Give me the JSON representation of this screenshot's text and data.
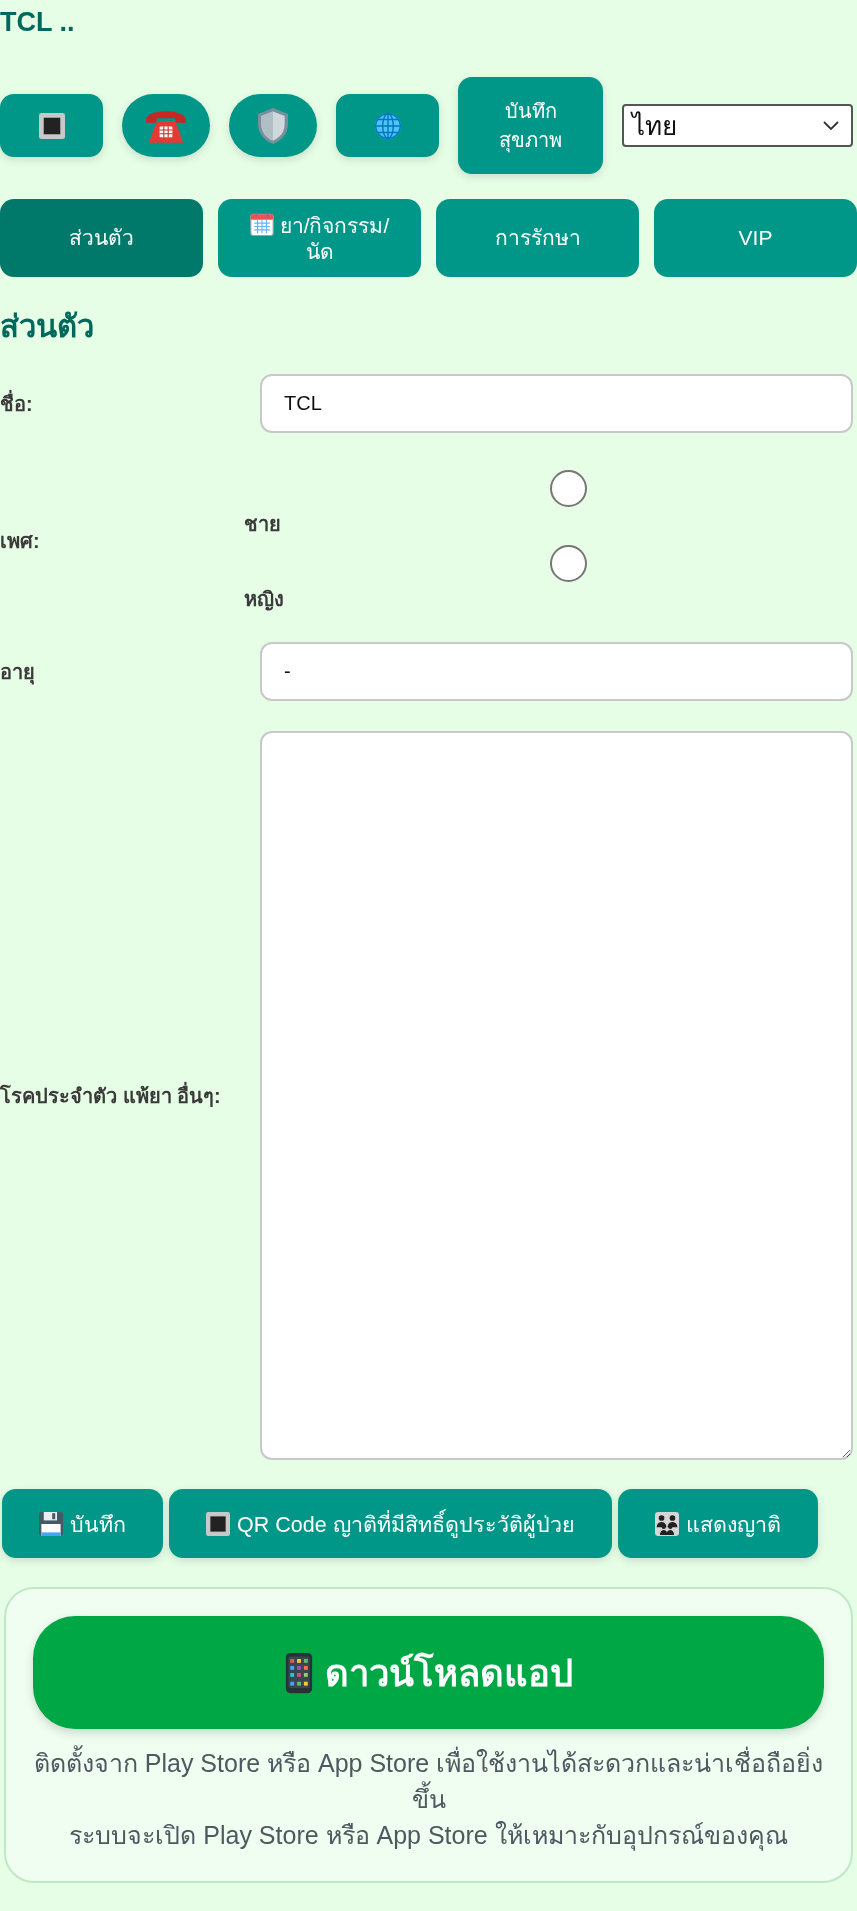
{
  "header": {
    "title": "TCL .."
  },
  "toolbar": {
    "buttons": [
      {
        "kind": "square"
      },
      {
        "kind": "phone"
      },
      {
        "kind": "shield"
      },
      {
        "kind": "globe"
      },
      {
        "kind": "text",
        "label": "บันทึก สุขภาพ"
      }
    ],
    "language_select": {
      "value": "ไทย"
    }
  },
  "tabs": [
    {
      "kind": "plain",
      "label": "ส่วนตัว",
      "selected": true
    },
    {
      "kind": "calendar",
      "label": "ยา/กิจกรรม/นัด",
      "selected": false
    },
    {
      "kind": "plain",
      "label": "การรักษา",
      "selected": false
    },
    {
      "kind": "plain",
      "label": "VIP",
      "selected": false
    }
  ],
  "form": {
    "heading": "ส่วนตัว",
    "fields": [
      {
        "kind": "text",
        "label": "ชื่อ:",
        "value": "TCL"
      },
      {
        "kind": "radio",
        "label": "เพศ:",
        "options": [
          {
            "label": "ชาย",
            "selected": false
          },
          {
            "label": "หญิง",
            "selected": false
          }
        ]
      },
      {
        "kind": "text",
        "label": "อายุ",
        "value": "-"
      },
      {
        "kind": "textarea",
        "label": "โรคประจำตัว แพ้ยา อื่นๆ:"
      }
    ]
  },
  "actions": [
    {
      "kind": "save",
      "label": "บันทึก"
    },
    {
      "kind": "qr",
      "label": "QR Code ญาติที่มีสิทธิ์ดูประวัติผู้ป่วย"
    },
    {
      "kind": "family",
      "label": "แสดงญาติ"
    }
  ],
  "download_card": {
    "button": "ดาวน์โหลดแอป",
    "lines": [
      "ติดตั้งจาก Play Store หรือ App Store เพื่อใช้งานได้สะดวกและน่าเชื่อถือยิ่งขึ้น",
      "ระบบจะเปิด Play Store หรือ App Store ให้เหมาะกับอุปกรณ์ของคุณ"
    ]
  }
}
